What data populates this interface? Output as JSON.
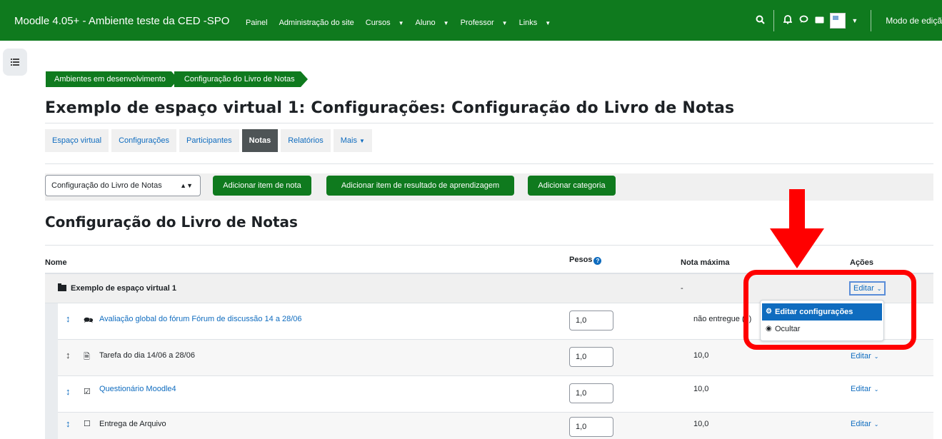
{
  "app": {
    "site_title": "Moodle 4.05+ - Ambiente teste da CED -SPO",
    "primary_nav": [
      {
        "label": "Painel",
        "has_dropdown": false
      },
      {
        "label": "Administração do site",
        "has_dropdown": false
      },
      {
        "label": "Cursos",
        "has_dropdown": true
      },
      {
        "label": "Aluno",
        "has_dropdown": true
      },
      {
        "label": "Professor",
        "has_dropdown": true
      },
      {
        "label": "Links",
        "has_dropdown": true
      }
    ],
    "edit_mode_label": "Modo de ediçã",
    "icons": {
      "search": "search-icon",
      "notifications": "bell-icon",
      "messages": "chat-icon",
      "mail": "envelope-icon",
      "avatar": "user-avatar",
      "drawer": "course-index-icon"
    },
    "brand_color": "#0f7a1e",
    "link_color": "#0f6cbf"
  },
  "breadcrumb": [
    "Ambientes em desenvolvimento",
    "Configuração do Livro de Notas"
  ],
  "page_title": "Exemplo de espaço virtual 1: Configurações: Configuração do Livro de Notas",
  "tabs": [
    {
      "label": "Espaço virtual",
      "active": false
    },
    {
      "label": "Configurações",
      "active": false
    },
    {
      "label": "Participantes",
      "active": false
    },
    {
      "label": "Notas",
      "active": true
    },
    {
      "label": "Relatórios",
      "active": false
    },
    {
      "label": "Mais",
      "active": false
    }
  ],
  "toolbar": {
    "select_value": "Configuração do Livro de Notas",
    "buttons": [
      "Adicionar item de nota",
      "Adicionar item de resultado de aprendizagem",
      "Adicionar categoria"
    ]
  },
  "section_heading": "Configuração do Livro de Notas",
  "table": {
    "headers": {
      "name": "Nome",
      "weights": "Pesos",
      "max_grade": "Nota máxima",
      "actions": "Ações"
    },
    "category": {
      "name": "Exemplo de espaço virtual 1",
      "max_grade": "-",
      "action": "Editar"
    },
    "items": [
      {
        "name": "Avaliação global do fórum Fórum de discussão 14 a 28/06",
        "type_icon": "forum-icon",
        "weight": "1,0",
        "max_grade": "não entregue (2)",
        "action": "Editar",
        "link": true
      },
      {
        "name": "Tarefa do dia 14/06 a 28/06",
        "type_icon": "assignment-icon",
        "weight": "1,0",
        "max_grade": "10,0",
        "action": "Editar",
        "link": false
      },
      {
        "name": "Questionário Moodle4",
        "type_icon": "quiz-icon",
        "weight": "1,0",
        "max_grade": "10,0",
        "action": "Editar",
        "link": true
      },
      {
        "name": "Entrega de Arquivo",
        "type_icon": "checkbox-icon",
        "weight": "1,0",
        "max_grade": "10,0",
        "action": "Editar",
        "link": false
      }
    ]
  },
  "dropdown_menu": {
    "items": [
      {
        "label": "Editar configurações",
        "icon": "gear-icon",
        "active": true
      },
      {
        "label": "Ocultar",
        "icon": "eye-icon",
        "active": false
      }
    ]
  },
  "annotation_color": "#ff0000"
}
